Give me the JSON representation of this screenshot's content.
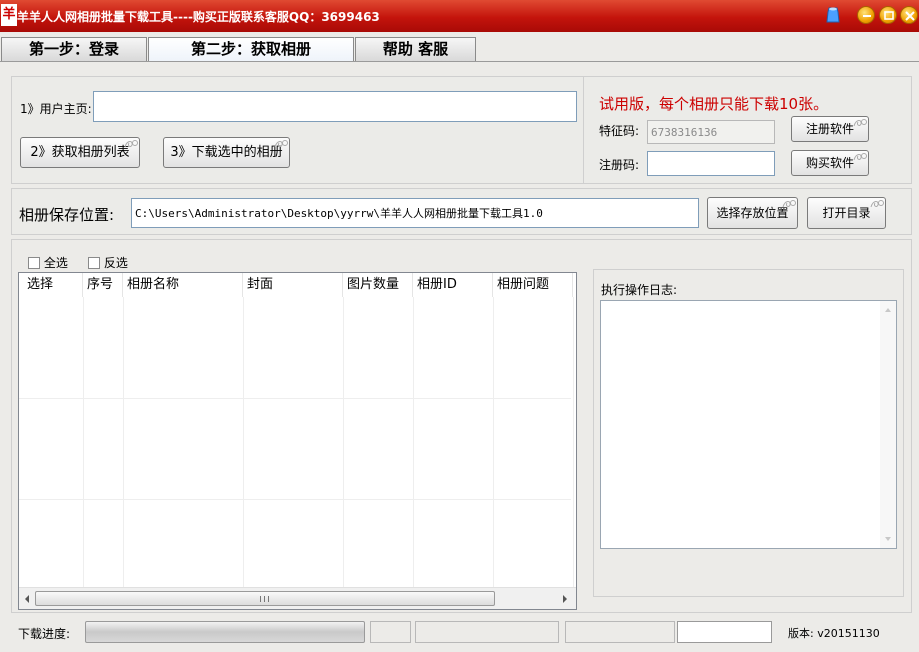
{
  "window": {
    "logo_char": "羊",
    "title": "羊羊人人网相册批量下载工具----购买正版联系客服QQ：3699463",
    "accent": "#c4140c"
  },
  "tabs": [
    {
      "label": "第一步：登录"
    },
    {
      "label": "第二步：获取相册"
    },
    {
      "label": "帮助 客服"
    }
  ],
  "top": {
    "user_home_label": "1》用户主页:",
    "user_home_value": "",
    "get_albums_button": "2》获取相册列表",
    "download_selected_button": "3》下载选中的相册",
    "trial_notice": "试用版，每个相册只能下载10张。",
    "trial_notice_color": "#cc0000",
    "feature_code_label": "特征码:",
    "feature_code_value": "6738316136",
    "register_code_label": "注册码:",
    "register_code_value": "",
    "register_button": "注册软件",
    "buy_button": "购买软件"
  },
  "save": {
    "label": "相册保存位置:",
    "path": "C:\\Users\\Administrator\\Desktop\\yyrrw\\羊羊人人网相册批量下载工具1.0",
    "choose_button": "选择存放位置",
    "open_button": "打开目录"
  },
  "list": {
    "select_all": "全选",
    "invert": "反选",
    "columns": [
      "选择",
      "序号",
      "相册名称",
      "封面",
      "图片数量",
      "相册ID",
      "相册问题"
    ]
  },
  "log": {
    "label": "执行操作日志:",
    "content": ""
  },
  "status": {
    "progress_label": "下载进度:",
    "progress": 0,
    "version": "版本: v20151130"
  }
}
